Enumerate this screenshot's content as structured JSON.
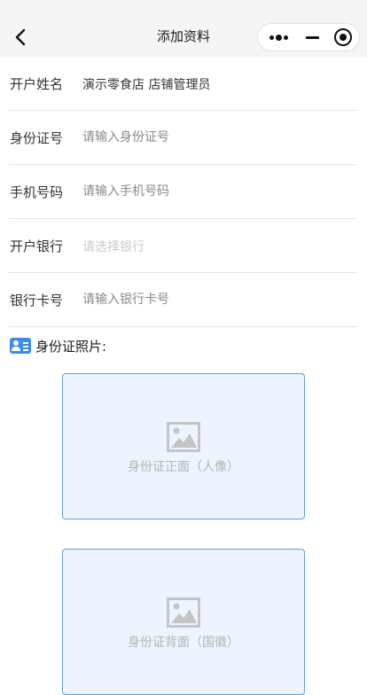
{
  "nav": {
    "title": "添加资料"
  },
  "form": {
    "holder": {
      "label": "开户姓名",
      "value": "演示零食店 店铺管理员"
    },
    "id_number": {
      "label": "身份证号",
      "placeholder": "请输入身份证号"
    },
    "phone": {
      "label": "手机号码",
      "placeholder": "请输入手机号码"
    },
    "bank": {
      "label": "开户银行",
      "placeholder": "请选择银行"
    },
    "card": {
      "label": "银行卡号",
      "placeholder": "请输入银行卡号"
    }
  },
  "photos": {
    "title": "身份证照片:",
    "front_caption": "身份证正面（人像）",
    "back_caption": "身份证背面（国徽）"
  },
  "colors": {
    "accent": "#3d8be8",
    "upload_bg": "#eef4ff",
    "upload_border": "#5c9de8"
  }
}
